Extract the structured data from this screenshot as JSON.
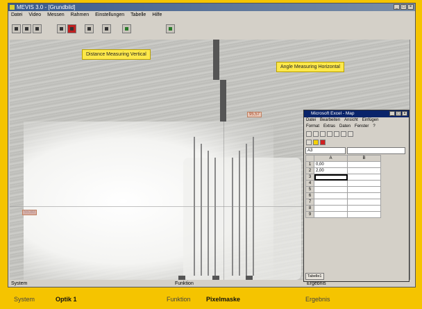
{
  "window": {
    "title": "MEVIS 3.0 - [Grundbild]",
    "buttons": [
      "_",
      "□",
      "×"
    ]
  },
  "menu": [
    "Datei",
    "Video",
    "Messen",
    "Rahmen",
    "Einstellungen",
    "Tabelle",
    "Hilfe"
  ],
  "toolbar": {
    "icons": [
      "camera-icon",
      "image-icon",
      "grid-icon",
      "split-icon",
      "stop-icon",
      "select-icon",
      "measure-icon",
      "person-icon",
      "tool-icon"
    ]
  },
  "overlay": {
    "measure_vertical": "Distance Measuring Vertical",
    "measure_horizontal": "Angle Measuring Horizontal",
    "value_label_1": "95,57",
    "value_label_2": "55,80"
  },
  "status": {
    "left": "System",
    "center": "Funktion",
    "right": "Ergebnis"
  },
  "footer": {
    "system_label": "System",
    "system_value": "Optik 1",
    "function_label": "Funktion",
    "function_value": "Pixelmaske",
    "result_label": "Ergebnis"
  },
  "excel": {
    "title": "Microsoft Excel - Map",
    "menu": [
      "Datei",
      "Bearbeiten",
      "Ansicht",
      "Einfügen",
      "Format",
      "Extras",
      "Daten",
      "Fenster",
      "?"
    ],
    "name_box": "A3",
    "col_headers": [
      "A",
      "B"
    ],
    "rows": [
      {
        "n": "1",
        "a": "0,00"
      },
      {
        "n": "2",
        "a": "2,00"
      },
      {
        "n": "3",
        "a": ""
      },
      {
        "n": "4",
        "a": ""
      },
      {
        "n": "5",
        "a": ""
      },
      {
        "n": "6",
        "a": ""
      },
      {
        "n": "7",
        "a": ""
      },
      {
        "n": "8",
        "a": ""
      },
      {
        "n": "9",
        "a": ""
      }
    ],
    "sheet_tab": "Tabelle1"
  }
}
